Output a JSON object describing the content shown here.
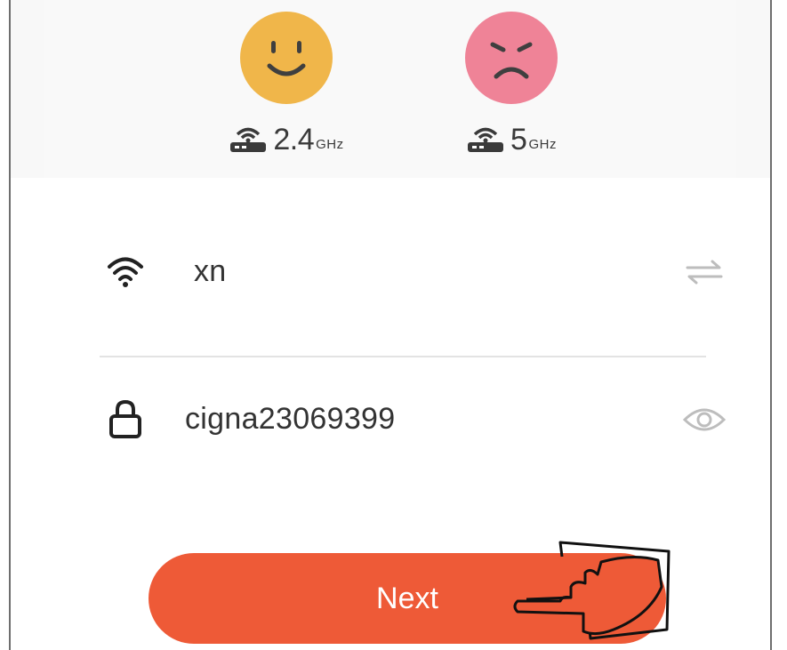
{
  "bands": [
    {
      "main": "2.4",
      "unit": "GHz",
      "status": "supported",
      "face_color": "#f0b64a"
    },
    {
      "main": "5",
      "unit": "GHz",
      "status": "unsupported",
      "face_color": "#ef8397"
    }
  ],
  "wifi": {
    "ssid_value": "xn",
    "password_value": "cigna23069399"
  },
  "actions": {
    "next_label": "Next"
  },
  "colors": {
    "accent": "#ee5a37",
    "text": "#333333",
    "icon_gray": "#bdbdbd"
  },
  "icons": {
    "ssid": "wifi-icon",
    "swap": "swap-arrows-icon",
    "password": "lock-icon",
    "visibility": "eye-icon",
    "band": "router-icon",
    "pointer": "hand-pointer-icon"
  }
}
